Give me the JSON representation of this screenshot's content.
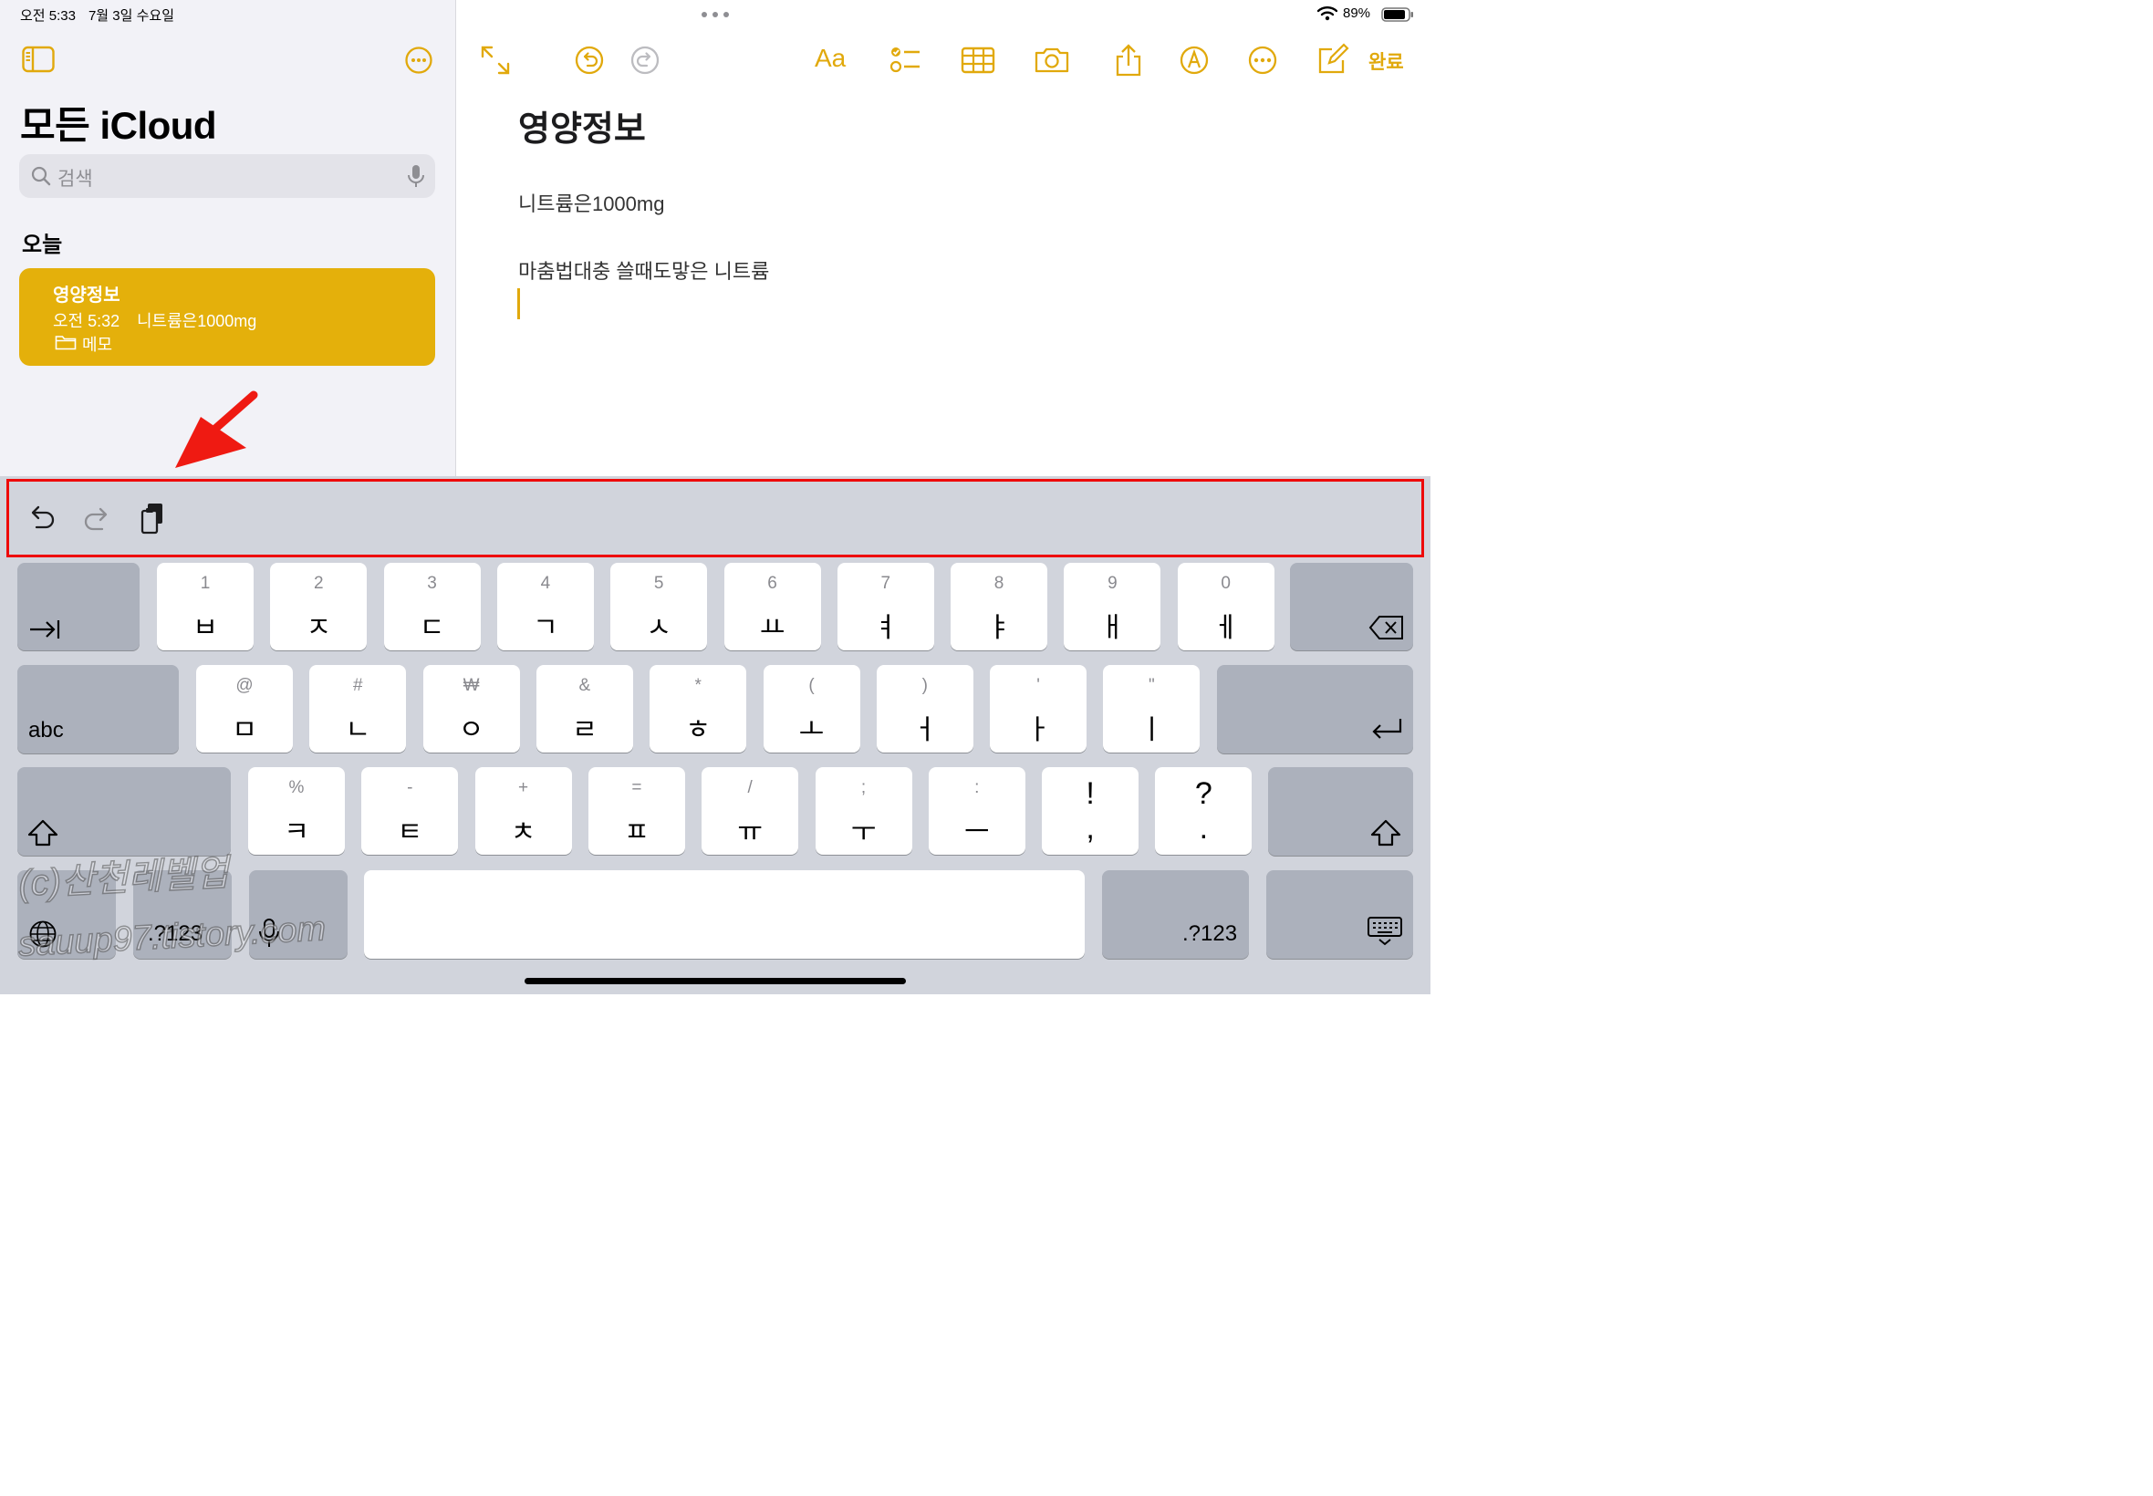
{
  "status": {
    "time": "오전 5:33",
    "date": "7월 3일 수요일",
    "battery": "89%"
  },
  "sidebar": {
    "title": "모든 iCloud",
    "search_placeholder": "검색",
    "section_today": "오늘",
    "note_card": {
      "title": "영양정보",
      "time": "오전 5:32",
      "preview": "니트륨은1000mg",
      "folder": "메모"
    }
  },
  "toolbar": {
    "format_label": "Aa",
    "done_label": "완료",
    "icons": [
      "expand-icon",
      "undo-icon",
      "redo-icon",
      "format-icon",
      "checklist-icon",
      "table-icon",
      "camera-icon",
      "share-icon",
      "markup-icon",
      "more-icon",
      "compose-icon"
    ]
  },
  "note": {
    "title": "영양정보",
    "line1": "니트륨은1000mg",
    "line2": "마춤법대충 쓸때도맣은 니트륨"
  },
  "keyboard": {
    "row1": [
      {
        "sub": "1",
        "main": "ㅂ"
      },
      {
        "sub": "2",
        "main": "ㅈ"
      },
      {
        "sub": "3",
        "main": "ㄷ"
      },
      {
        "sub": "4",
        "main": "ㄱ"
      },
      {
        "sub": "5",
        "main": "ㅅ"
      },
      {
        "sub": "6",
        "main": "ㅛ"
      },
      {
        "sub": "7",
        "main": "ㅕ"
      },
      {
        "sub": "8",
        "main": "ㅑ"
      },
      {
        "sub": "9",
        "main": "ㅐ"
      },
      {
        "sub": "0",
        "main": "ㅔ"
      }
    ],
    "row2": [
      {
        "sub": "@",
        "main": "ㅁ"
      },
      {
        "sub": "#",
        "main": "ㄴ"
      },
      {
        "sub": "₩",
        "main": "ㅇ"
      },
      {
        "sub": "&",
        "main": "ㄹ"
      },
      {
        "sub": "*",
        "main": "ㅎ"
      },
      {
        "sub": "(",
        "main": "ㅗ"
      },
      {
        "sub": ")",
        "main": "ㅓ"
      },
      {
        "sub": "'",
        "main": "ㅏ"
      },
      {
        "sub": "\"",
        "main": "ㅣ"
      }
    ],
    "row3": [
      {
        "sub": "%",
        "main": "ㅋ"
      },
      {
        "sub": "-",
        "main": "ㅌ"
      },
      {
        "sub": "+",
        "main": "ㅊ"
      },
      {
        "sub": "=",
        "main": "ㅍ"
      },
      {
        "sub": "/",
        "main": "ㅠ"
      },
      {
        "sub": ";",
        "main": "ㅜ"
      },
      {
        "sub": ":",
        "main": "ㅡ"
      },
      {
        "sub": "!",
        "main": ","
      },
      {
        "sub": "?",
        "main": "."
      }
    ],
    "abc_label": "abc",
    "numbers_label": ".?123",
    "numbers_label_right": ".?123"
  },
  "watermark": {
    "line1": "(c)산천레벨업",
    "line2": "sauup97.tistory.com"
  },
  "colors": {
    "accent": "#e1a90c",
    "note_card": "#e4b00b",
    "highlight": "#ee0a0a"
  }
}
